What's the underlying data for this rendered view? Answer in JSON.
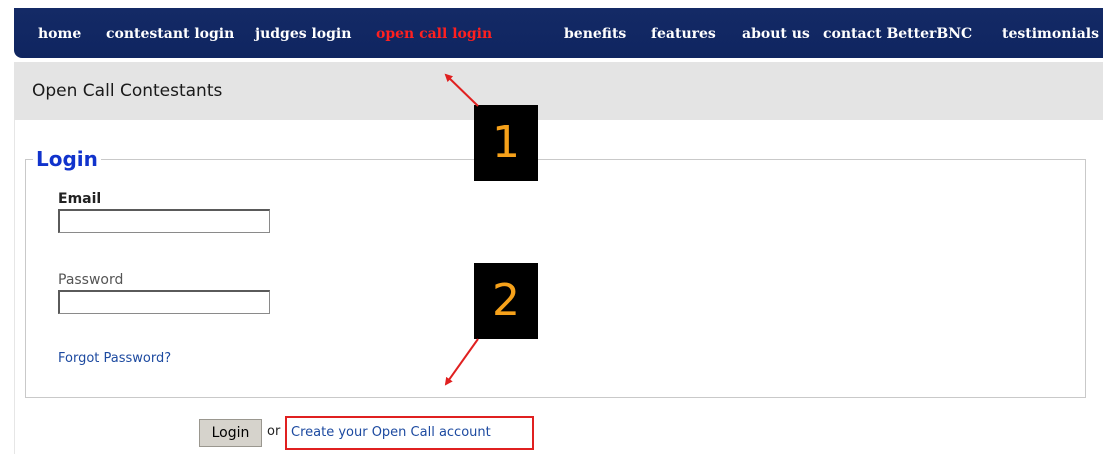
{
  "nav": {
    "items": [
      {
        "label": "home",
        "active": false
      },
      {
        "label": "contestant login",
        "active": false
      },
      {
        "label": "judges login",
        "active": false
      },
      {
        "label": "open call login",
        "active": true
      },
      {
        "label": "benefits",
        "active": false
      },
      {
        "label": "features",
        "active": false
      },
      {
        "label": "about us",
        "active": false
      },
      {
        "label": "contact BetterBNC",
        "active": false
      },
      {
        "label": "testimonials",
        "active": false
      }
    ],
    "background_color": "#132a66",
    "active_color": "#ff2020"
  },
  "header": {
    "title": "Open Call Contestants"
  },
  "login": {
    "legend": "Login",
    "email_label": "Email",
    "email_value": "",
    "password_label": "Password",
    "password_value": "",
    "forgot_link": "Forgot Password?",
    "button_label": "Login",
    "or_text": "or",
    "create_account_link": "Create your Open Call account"
  },
  "callouts": [
    {
      "label": "1",
      "target": "open call login"
    },
    {
      "label": "2",
      "target": "Create your Open Call account"
    }
  ],
  "colors": {
    "legend": "#1133cc",
    "link": "#1d4aa0",
    "highlight_border": "#e02020",
    "callout_text": "#f6a11a",
    "header_strip": "#e4e4e4"
  }
}
